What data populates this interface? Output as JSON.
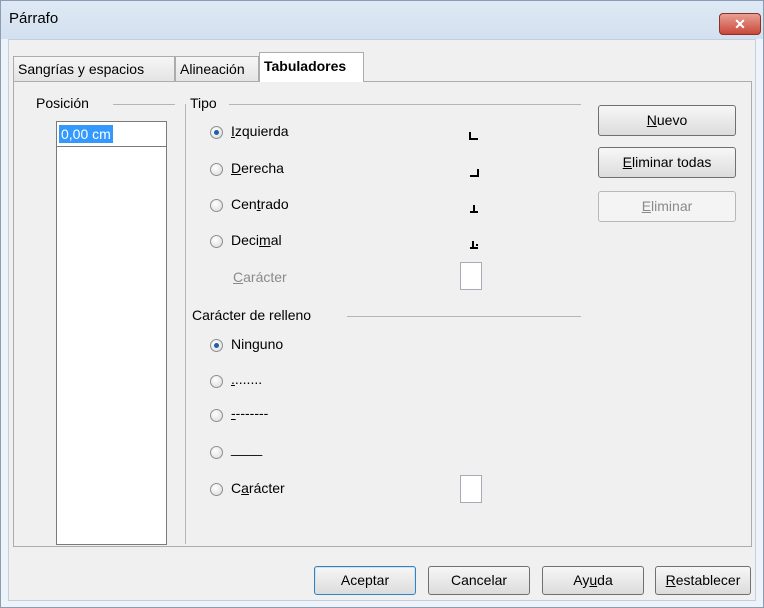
{
  "window": {
    "title": "Párrafo",
    "close_glyph": "✕"
  },
  "tabs": [
    {
      "label": "Sangrías y espacios",
      "active": false
    },
    {
      "label": "Alineación",
      "active": false
    },
    {
      "label": "Tabuladores",
      "active": true
    }
  ],
  "position": {
    "group_label": "Posición",
    "value": "0,00 cm"
  },
  "tipo": {
    "group_label": "Tipo",
    "options": [
      {
        "pre": "",
        "mnemonic": "I",
        "post": "zquierda",
        "checked": true
      },
      {
        "pre": "",
        "mnemonic": "D",
        "post": "erecha",
        "checked": false
      },
      {
        "pre": "Cen",
        "mnemonic": "t",
        "post": "rado",
        "checked": false
      },
      {
        "pre": "Deci",
        "mnemonic": "m",
        "post": "al",
        "checked": false
      }
    ],
    "character": {
      "pre": "",
      "mnemonic": "C",
      "post": "arácter"
    }
  },
  "fill": {
    "group_label": "Carácter de relleno",
    "options": [
      {
        "pre": "Ninguno",
        "mnemonic": "",
        "post": "",
        "checked": true
      },
      {
        "pre": "",
        "mnemonic": ".",
        "post": ".......",
        "checked": false
      },
      {
        "pre": "",
        "mnemonic": "-",
        "post": "-------",
        "checked": false
      },
      {
        "pre": "",
        "mnemonic": "_",
        "post": "___",
        "checked": false
      },
      {
        "pre": "C",
        "mnemonic": "a",
        "post": "rácter",
        "checked": false
      }
    ]
  },
  "side_buttons": {
    "new": {
      "pre": "",
      "mnemonic": "N",
      "post": "uevo"
    },
    "delete_all": {
      "pre": "",
      "mnemonic": "E",
      "post": "liminar todas"
    },
    "delete": {
      "pre": "",
      "mnemonic": "E",
      "post": "liminar"
    }
  },
  "footer_buttons": {
    "ok": "Aceptar",
    "cancel": "Cancelar",
    "help": {
      "pre": "Ay",
      "mnemonic": "u",
      "post": "da"
    },
    "reset": {
      "pre": "",
      "mnemonic": "R",
      "post": "establecer"
    }
  },
  "colors": {
    "selection": "#3399ff",
    "radio_dot": "#1f5ea8",
    "close_button": "#c9483a"
  }
}
